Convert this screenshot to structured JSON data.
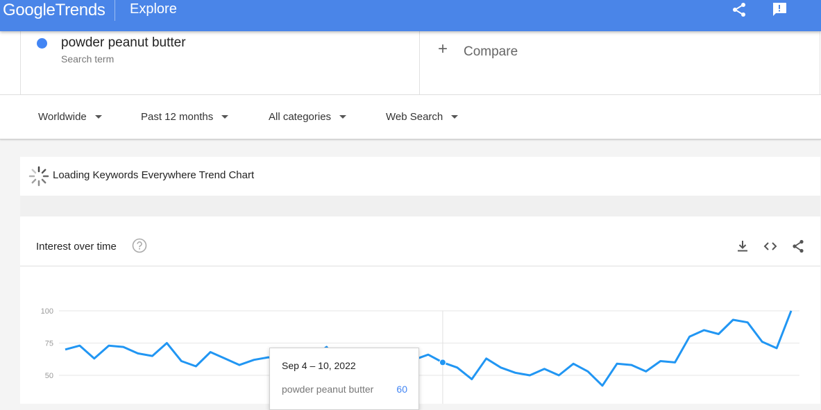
{
  "header": {
    "logo": {
      "google": "Google",
      "trends": "Trends"
    },
    "section": "Explore",
    "icons": [
      "share-icon",
      "feedback-icon"
    ]
  },
  "search": {
    "term": "powder peanut butter",
    "term_type": "Search term",
    "compare_label": "Compare",
    "term_color": "#4285f4"
  },
  "filters": [
    {
      "label": "Worldwide"
    },
    {
      "label": "Past 12 months"
    },
    {
      "label": "All categories"
    },
    {
      "label": "Web Search"
    }
  ],
  "extension": {
    "loading_text": "Loading Keywords Everywhere Trend Chart"
  },
  "interest": {
    "title": "Interest over time",
    "actions": [
      "download-icon",
      "embed-icon",
      "share-icon"
    ]
  },
  "tooltip": {
    "date": "Sep 4 – 10, 2022",
    "term": "powder peanut butter",
    "value": "60"
  },
  "chart_data": {
    "type": "line",
    "series": [
      {
        "name": "powder peanut butter",
        "color": "#2196f3",
        "values": [
          70,
          73,
          63,
          73,
          72,
          67,
          65,
          75,
          61,
          57,
          68,
          63,
          58,
          62,
          64,
          60,
          59,
          63,
          72,
          57,
          69,
          68,
          68,
          62,
          62,
          66,
          60,
          56,
          47,
          63,
          56,
          52,
          50,
          55,
          50,
          59,
          53,
          42,
          59,
          58,
          53,
          61,
          60,
          80,
          85,
          82,
          93,
          91,
          76,
          71,
          100
        ]
      }
    ],
    "yticks": [
      50,
      75,
      100
    ],
    "ylim_visible": [
      50,
      100
    ],
    "highlight_index": 26,
    "grid": true
  }
}
